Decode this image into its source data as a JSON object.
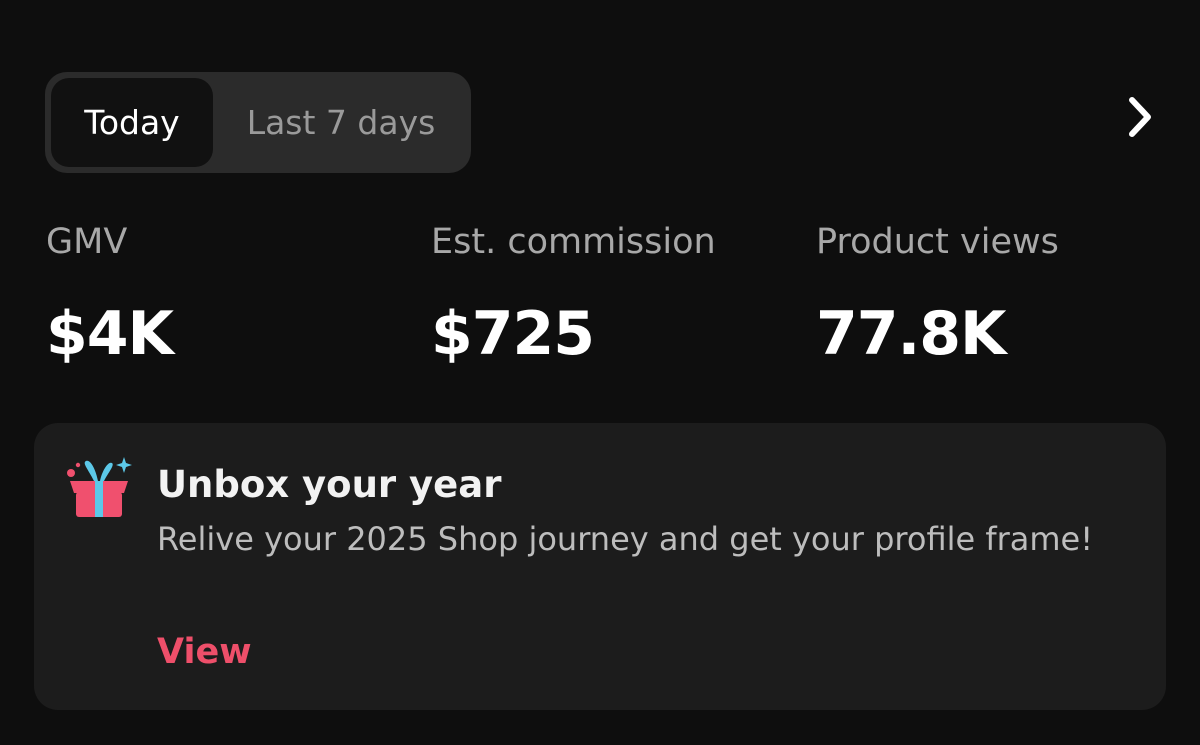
{
  "range_tabs": {
    "selected": "Today",
    "options": [
      "Today",
      "Last 7 days"
    ]
  },
  "navigation": {
    "next_icon": "chevron-right-icon"
  },
  "metrics": [
    {
      "label": "GMV",
      "value": "$4K"
    },
    {
      "label": "Est. commission",
      "value": "$725"
    },
    {
      "label": "Product views",
      "value": "77.8K"
    }
  ],
  "promo_card": {
    "icon": "gift-box-icon",
    "title": "Unbox your year",
    "description": "Relive your 2025 Shop journey and get your profile frame!",
    "link_label": "View"
  },
  "colors": {
    "background": "#0e0e0e",
    "card_background": "#1c1c1c",
    "segment_background": "#2b2b2b",
    "accent": "#ee4f6a",
    "gift_pink": "#f0506e",
    "gift_ribbon": "#5cc8e8"
  }
}
